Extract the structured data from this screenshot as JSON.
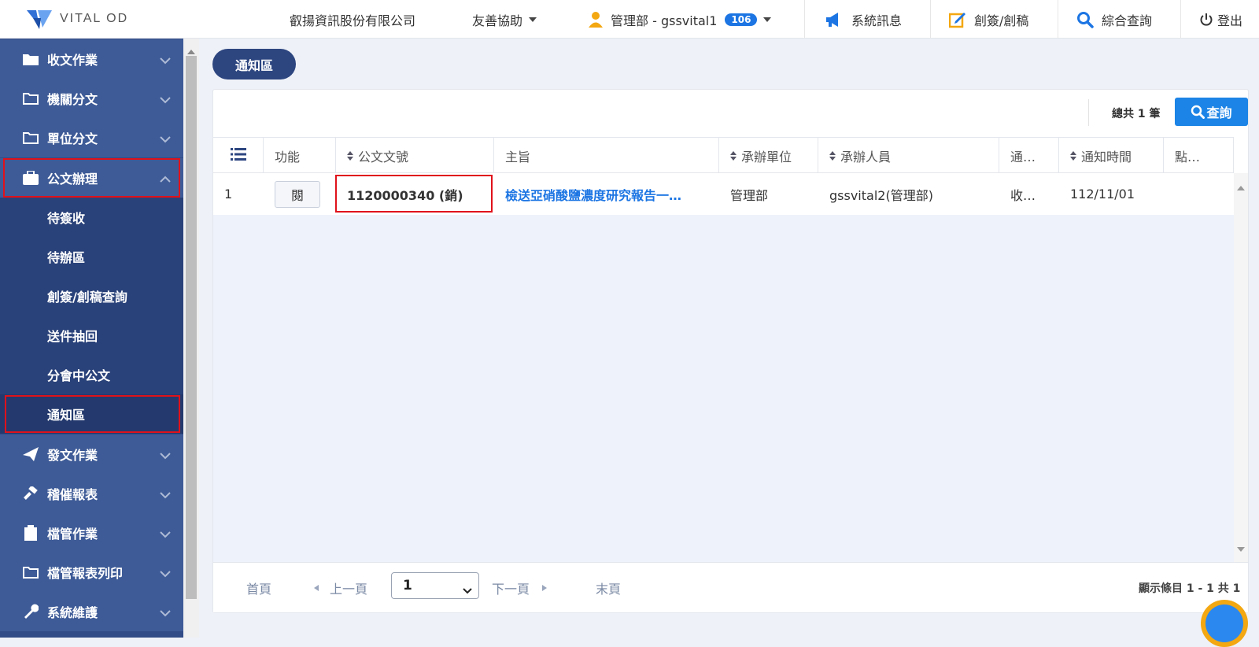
{
  "header": {
    "logo_text": "VITAL OD",
    "company": "叡揚資訊股份有限公司",
    "assist": "友善協助",
    "user": "管理部 - gssvital1",
    "user_badge": "106",
    "system_msg": "系統訊息",
    "create_sign": "創簽/創稿",
    "search": "綜合查詢",
    "logout": "登出"
  },
  "sidebar": {
    "items": [
      {
        "label": "收文作業"
      },
      {
        "label": "機關分文"
      },
      {
        "label": "單位分文"
      },
      {
        "label": "公文辦理"
      },
      {
        "label": "發文作業"
      },
      {
        "label": "稽催報表"
      },
      {
        "label": "檔管作業"
      },
      {
        "label": "檔管報表列印"
      },
      {
        "label": "系統維護"
      }
    ],
    "sub_items": [
      {
        "label": "待簽收"
      },
      {
        "label": "待辦區"
      },
      {
        "label": "創簽/創稿查詢"
      },
      {
        "label": "送件抽回"
      },
      {
        "label": "分會中公文"
      },
      {
        "label": "通知區"
      }
    ]
  },
  "main": {
    "tab_label": "通知區",
    "total_text": "總共 1 筆",
    "query_label": "查詢",
    "columns": [
      "功能",
      "公文文號",
      "主旨",
      "承辦單位",
      "承辦人員",
      "通…",
      "通知時間",
      "點…"
    ],
    "rows": [
      {
        "index": "1",
        "action": "閱",
        "doc_no": "1120000340 (銷)",
        "subject": "檢送亞硝酸鹽濃度研究報告一…",
        "dept": "管理部",
        "handler": "gssvital2(管理部)",
        "notify_type": "收…",
        "notify_time": "112/11/01",
        "clicked": ""
      }
    ],
    "pagination": {
      "first": "首頁",
      "prev": "上一頁",
      "page": "1",
      "next": "下一頁",
      "last": "末頁",
      "summary": "顯示條目 1 - 1 共 1"
    }
  },
  "colors": {
    "sidebar_bg": "#3e5b97",
    "sidebar_sub_bg": "#2a427a",
    "accent": "#1c84e6",
    "highlight_border": "#e0121b"
  }
}
